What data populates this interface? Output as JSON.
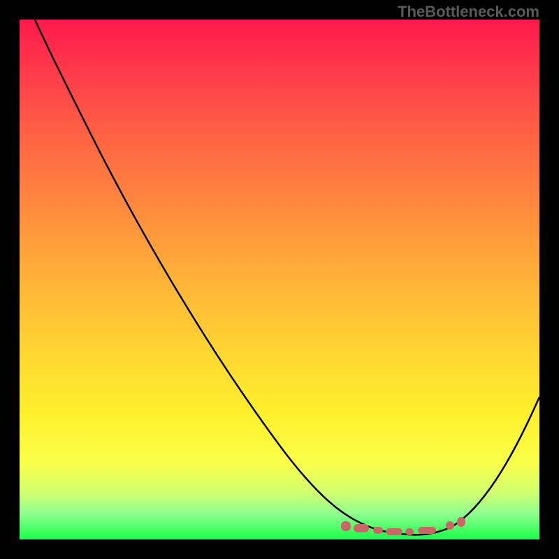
{
  "watermark": "TheBottleneck.com",
  "chart_data": {
    "type": "line",
    "title": "",
    "xlabel": "",
    "ylabel": "",
    "xlim": [
      0,
      100
    ],
    "ylim": [
      0,
      100
    ],
    "series": [
      {
        "name": "curve",
        "x": [
          3,
          8,
          15,
          25,
          35,
          45,
          55,
          62,
          67,
          70,
          74,
          78,
          82,
          86,
          90,
          95,
          100
        ],
        "y": [
          100,
          93,
          83,
          69,
          55,
          41,
          27,
          16,
          8,
          4,
          1,
          0.5,
          1,
          4,
          10,
          20,
          33
        ]
      }
    ],
    "annotations": {
      "optimal_band": {
        "center_x": 76,
        "width": 22
      }
    },
    "gradient_note": "background red-to-green top-to-bottom"
  }
}
